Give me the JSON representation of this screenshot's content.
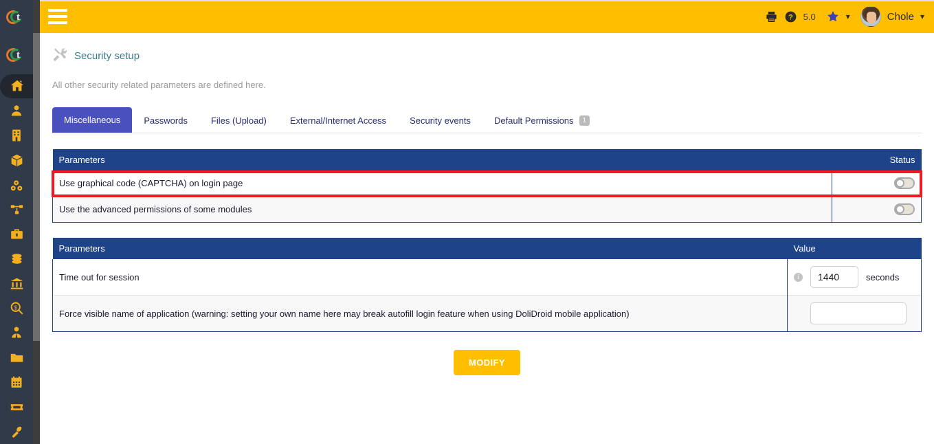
{
  "topbar": {
    "menu_icon": "hamburger-icon",
    "print_icon": "print-icon",
    "help_icon": "help-circle-icon",
    "version": "5.0",
    "bookmark_icon": "star-icon",
    "bookmark_chevron": "chevron-down-icon",
    "user_name": "Chole",
    "user_chevron": "chevron-down-icon"
  },
  "sidebar": {
    "logo_letter": "t",
    "items": [
      {
        "name": "home",
        "icon": "home-icon",
        "active": true
      },
      {
        "name": "third-parties",
        "icon": "user-icon",
        "active": false
      },
      {
        "name": "contacts",
        "icon": "building-icon",
        "active": false
      },
      {
        "name": "products",
        "icon": "box-icon",
        "active": false
      },
      {
        "name": "mrp",
        "icon": "factory-icon",
        "active": false
      },
      {
        "name": "projects",
        "icon": "sitemap-icon",
        "active": false
      },
      {
        "name": "commercial",
        "icon": "briefcase-icon",
        "active": false
      },
      {
        "name": "billing",
        "icon": "coins-icon",
        "active": false
      },
      {
        "name": "bank",
        "icon": "bank-icon",
        "active": false
      },
      {
        "name": "accounting",
        "icon": "search-dollar-icon",
        "active": false
      },
      {
        "name": "hrm",
        "icon": "user-tie-icon",
        "active": false
      },
      {
        "name": "documents",
        "icon": "folder-icon",
        "active": false
      },
      {
        "name": "agenda",
        "icon": "calendar-icon",
        "active": false
      },
      {
        "name": "ticket",
        "icon": "ticket-icon",
        "active": false
      },
      {
        "name": "setup",
        "icon": "wrench-icon",
        "active": false
      }
    ]
  },
  "page": {
    "icon": "tools-icon",
    "title": "Security setup",
    "description": "All other security related parameters are defined here."
  },
  "tabs": [
    {
      "label": "Miscellaneous",
      "active": true,
      "badge": null
    },
    {
      "label": "Passwords",
      "active": false,
      "badge": null
    },
    {
      "label": "Files (Upload)",
      "active": false,
      "badge": null
    },
    {
      "label": "External/Internet Access",
      "active": false,
      "badge": null
    },
    {
      "label": "Security events",
      "active": false,
      "badge": null
    },
    {
      "label": "Default Permissions",
      "active": false,
      "badge": "1"
    }
  ],
  "table_status": {
    "headers": {
      "parameters": "Parameters",
      "status": "Status"
    },
    "rows": [
      {
        "label": "Use graphical code (CAPTCHA) on login page",
        "toggle": "off",
        "highlighted": true
      },
      {
        "label": "Use the advanced permissions of some modules",
        "toggle": "off",
        "highlighted": false
      }
    ]
  },
  "table_value": {
    "headers": {
      "parameters": "Parameters",
      "value": "Value"
    },
    "rows": [
      {
        "label": "Time out for session",
        "has_info": true,
        "info_icon": "info-icon",
        "input_value": "1440",
        "input_placeholder": "",
        "unit": "seconds",
        "input_size": "small"
      },
      {
        "label": "Force visible name of application (warning: setting your own name here may break autofill login feature when using DoliDroid mobile application)",
        "has_info": false,
        "info_icon": "",
        "input_value": "",
        "input_placeholder": "",
        "unit": "",
        "input_size": "big"
      }
    ]
  },
  "actions": {
    "modify_label": "MODIFY"
  },
  "colors": {
    "topbar": "#FFBF00",
    "table_header": "#1F4388",
    "active_tab": "#4A51BE",
    "highlight": "#ED1C24",
    "rail": "#313A49",
    "rail_icon": "#F2B01E",
    "title": "#3A7B8C"
  }
}
